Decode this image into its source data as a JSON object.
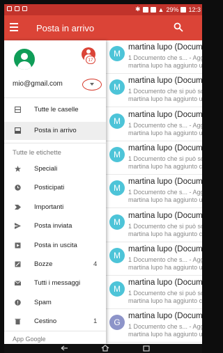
{
  "status_bar": {
    "battery": "29%",
    "time": "12:3"
  },
  "app_bar": {
    "title": "Posta in arrivo"
  },
  "account": {
    "email": "mio@gmail.com",
    "badge": "17"
  },
  "colors": {
    "accent": "#db4437",
    "status": "#c1332b",
    "avatar_cyan": "#4dc4d8",
    "avatar_grey": "#8d94c9"
  },
  "drawer": {
    "top_items": [
      {
        "label": "Tutte le caselle",
        "icon": "all-inboxes-icon"
      },
      {
        "label": "Posta in arrivo",
        "icon": "inbox-icon",
        "selected": true
      }
    ],
    "section_label": "Tutte le etichette",
    "labels": [
      {
        "label": "Speciali",
        "icon": "star-icon"
      },
      {
        "label": "Posticipati",
        "icon": "clock-icon"
      },
      {
        "label": "Importanti",
        "icon": "important-icon"
      },
      {
        "label": "Posta inviata",
        "icon": "send-icon"
      },
      {
        "label": "Posta in uscita",
        "icon": "outbox-icon"
      },
      {
        "label": "Bozze",
        "icon": "draft-icon",
        "count": "4"
      },
      {
        "label": "Tutti i messaggi",
        "icon": "all-mail-icon"
      },
      {
        "label": "Spam",
        "icon": "spam-icon"
      },
      {
        "label": "Cestino",
        "icon": "trash-icon",
        "count": "1"
      }
    ],
    "apps_label": "App Google"
  },
  "messages": [
    {
      "avatar": "M",
      "sender": "martina lupo (Documen",
      "line1": "1 Documento che s... - Aggi",
      "line2": "martina lupo ha aggiunto un"
    },
    {
      "avatar": "M",
      "sender": "martina lupo (Documen",
      "line1": "1 Documento che si può sol",
      "line2": "martina lupo ha aggiunto un"
    },
    {
      "avatar": "M",
      "sender": "martina lupo (Documen",
      "line1": "1 Documento che s... - Aggi",
      "line2": "martina lupo ha aggiunto un"
    },
    {
      "avatar": "M",
      "sender": "martina lupo (Documen",
      "line1": "1 Documento che si può sol",
      "line2": "martina lupo ha aggiunto co"
    },
    {
      "avatar": "M",
      "sender": "martina lupo (Documen",
      "line1": "1 Documento che s... - Aggi",
      "line2": "martina lupo ha aggiunto un"
    },
    {
      "avatar": "M",
      "sender": "martina lupo (Documen",
      "line1": "1 Documento che si può sol",
      "line2": "martina lupo ha aggiunto co"
    },
    {
      "avatar": "M",
      "sender": "martina lupo (Documen",
      "line1": "1 Documento che s... - Aggi",
      "line2": "martina lupo ha aggiunto un"
    },
    {
      "avatar": "M",
      "sender": "martina lupo (Documen",
      "line1": "1 Documento che si può sol",
      "line2": "martina lupo ha aggiunto co"
    },
    {
      "avatar": "G",
      "sender": "martina lupo (Documen",
      "line1": "1 Documento che s... - Aggi",
      "line2": "martina lupo ha aggiunto un"
    }
  ]
}
